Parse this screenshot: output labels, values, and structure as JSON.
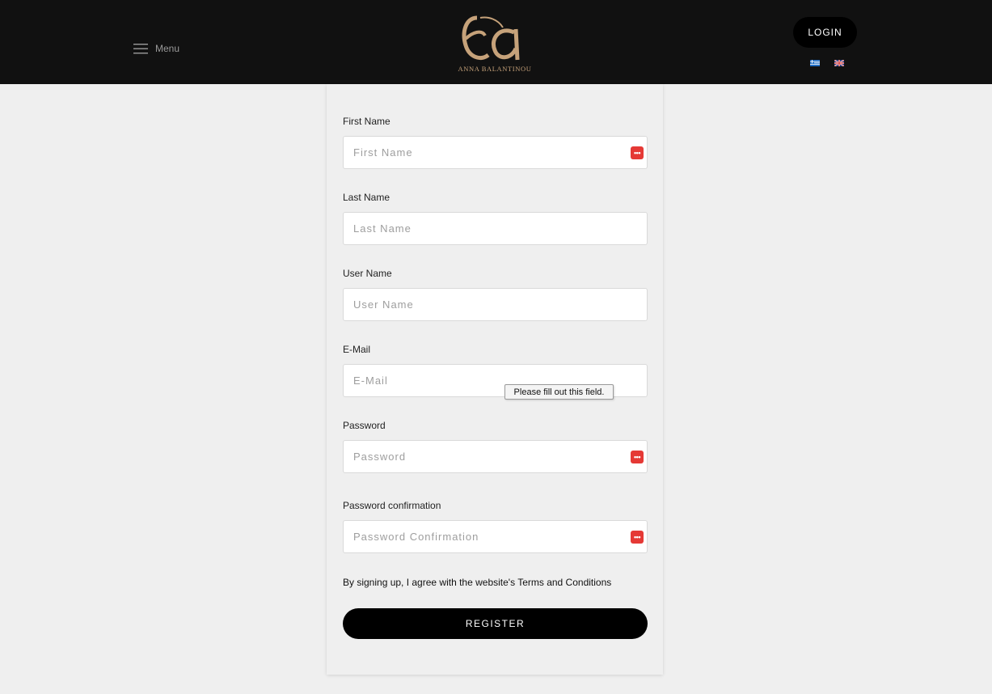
{
  "header": {
    "menu_label": "Menu",
    "logo_tagline": "ANNA BALANTINOU",
    "login_label": "LOGIN",
    "languages": [
      "greek-flag-icon",
      "uk-flag-icon"
    ]
  },
  "form": {
    "fields": [
      {
        "label": "First Name",
        "placeholder": "First Name",
        "value": ""
      },
      {
        "label": "Last Name",
        "placeholder": "Last Name",
        "value": ""
      },
      {
        "label": "User Name",
        "placeholder": "User Name",
        "value": ""
      },
      {
        "label": "E-Mail",
        "placeholder": "E-Mail",
        "value": ""
      },
      {
        "label": "Password",
        "placeholder": "Password",
        "value": ""
      },
      {
        "label": "Password confirmation",
        "placeholder": "Password Confirmation",
        "value": ""
      }
    ],
    "validation_tooltip": "Please fill out this field.",
    "terms_text": "By signing up, I agree with the website's Terms and Conditions",
    "register_label": "REGISTER"
  },
  "colors": {
    "header_bg": "#111111",
    "page_bg": "#efefef",
    "logo_gold": "#c6a27a",
    "button_bg": "#000000",
    "password_manager_icon": "#e53935"
  }
}
